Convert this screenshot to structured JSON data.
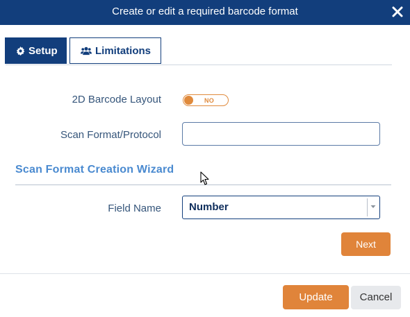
{
  "dialog": {
    "title": "Create or edit a required barcode format"
  },
  "tabs": [
    {
      "label": "Setup",
      "icon": "gear-icon",
      "active": true
    },
    {
      "label": "Limitations",
      "icon": "users-icon",
      "active": false
    }
  ],
  "form": {
    "layout_label": "2D Barcode Layout",
    "layout_toggle": {
      "state_text": "NO",
      "on": false
    },
    "protocol_label": "Scan Format/Protocol",
    "protocol_value": ""
  },
  "wizard": {
    "title": "Scan Format Creation Wizard",
    "field_name_label": "Field Name",
    "field_name_value": "Number",
    "next_label": "Next"
  },
  "footer": {
    "update_label": "Update",
    "cancel_label": "Cancel"
  },
  "colors": {
    "header": "#123e7c",
    "accent": "#e0843a",
    "section_title": "#4a8ad0"
  }
}
